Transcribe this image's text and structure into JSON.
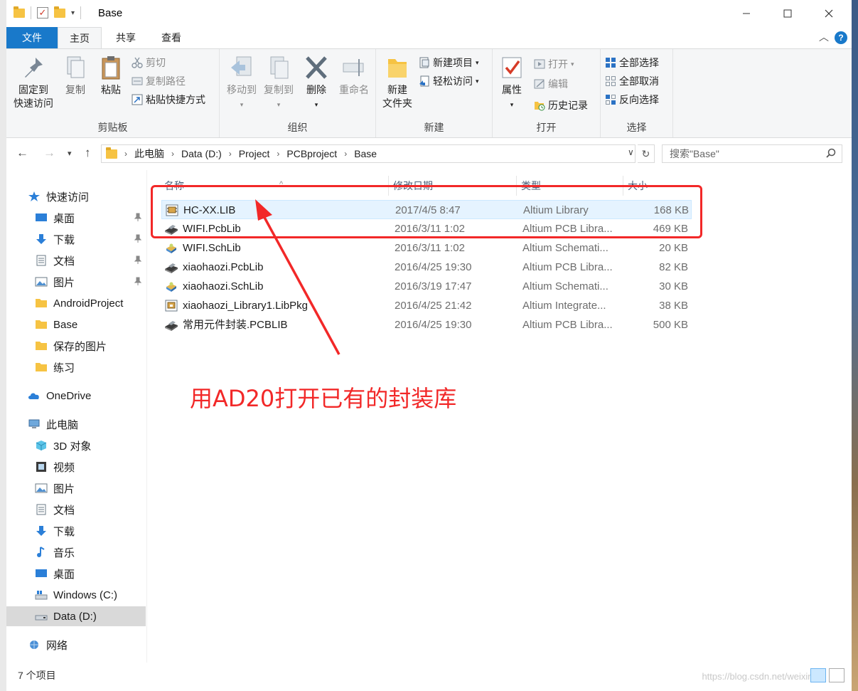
{
  "window": {
    "title": "Base"
  },
  "ribbon_tabs": [
    "文件",
    "主页",
    "共享",
    "查看"
  ],
  "ribbon": {
    "clipboard": {
      "label": "剪贴板",
      "pin_quick_access": "固定到\n快速访问",
      "copy": "复制",
      "paste": "粘贴",
      "cut": "剪切",
      "copy_path": "复制路径",
      "paste_shortcut": "粘贴快捷方式"
    },
    "organize": {
      "label": "组织",
      "move_to": "移动到",
      "copy_to": "复制到",
      "delete": "删除",
      "rename": "重命名"
    },
    "new": {
      "label": "新建",
      "new_folder": "新建\n文件夹",
      "new_item": "新建项目",
      "easy_access": "轻松访问"
    },
    "open": {
      "label": "打开",
      "properties": "属性",
      "open": "打开",
      "edit": "编辑",
      "history": "历史记录"
    },
    "select": {
      "label": "选择",
      "select_all": "全部选择",
      "select_none": "全部取消",
      "invert_selection": "反向选择"
    }
  },
  "address": {
    "crumbs": [
      "此电脑",
      "Data (D:)",
      "Project",
      "PCBproject",
      "Base"
    ],
    "search_placeholder": "搜索\"Base\""
  },
  "nav": {
    "quick_access": "快速访问",
    "items_pinned": [
      "桌面",
      "下载",
      "文档",
      "图片"
    ],
    "items_unpinned": [
      "AndroidProject",
      "Base",
      "保存的图片",
      "练习"
    ],
    "onedrive": "OneDrive",
    "this_pc": "此电脑",
    "pc_items": [
      "3D 对象",
      "视频",
      "图片",
      "文档",
      "下载",
      "音乐",
      "桌面",
      "Windows (C:)",
      "Data (D:)"
    ],
    "network": "网络"
  },
  "columns": {
    "name": "名称",
    "date": "修改日期",
    "type": "类型",
    "size": "大小"
  },
  "files": [
    {
      "name": "HC-XX.LIB",
      "date": "2017/4/5 8:47",
      "type": "Altium Library",
      "size": "168 KB",
      "icon": "lib-icon"
    },
    {
      "name": "WIFI.PcbLib",
      "date": "2016/3/11 1:02",
      "type": "Altium PCB Libra...",
      "size": "469 KB",
      "icon": "pcblib-icon"
    },
    {
      "name": "WIFI.SchLib",
      "date": "2016/3/11 1:02",
      "type": "Altium Schemati...",
      "size": "20 KB",
      "icon": "schlib-icon"
    },
    {
      "name": "xiaohaozi.PcbLib",
      "date": "2016/4/25 19:30",
      "type": "Altium PCB Libra...",
      "size": "82 KB",
      "icon": "pcblib-icon"
    },
    {
      "name": "xiaohaozi.SchLib",
      "date": "2016/3/19 17:47",
      "type": "Altium Schemati...",
      "size": "30 KB",
      "icon": "schlib-icon"
    },
    {
      "name": "xiaohaozi_Library1.LibPkg",
      "date": "2016/4/25 21:42",
      "type": "Altium Integrate...",
      "size": "38 KB",
      "icon": "libpkg-icon"
    },
    {
      "name": "常用元件封装.PCBLIB",
      "date": "2016/4/25 19:30",
      "type": "Altium PCB Libra...",
      "size": "500 KB",
      "icon": "pcblib-icon"
    }
  ],
  "annotation": {
    "text": "用AD20打开已有的封装库",
    "color": "#f22828"
  },
  "status": {
    "count": "7 个项目"
  },
  "watermark": "https://blog.csdn.net/weixin_3"
}
